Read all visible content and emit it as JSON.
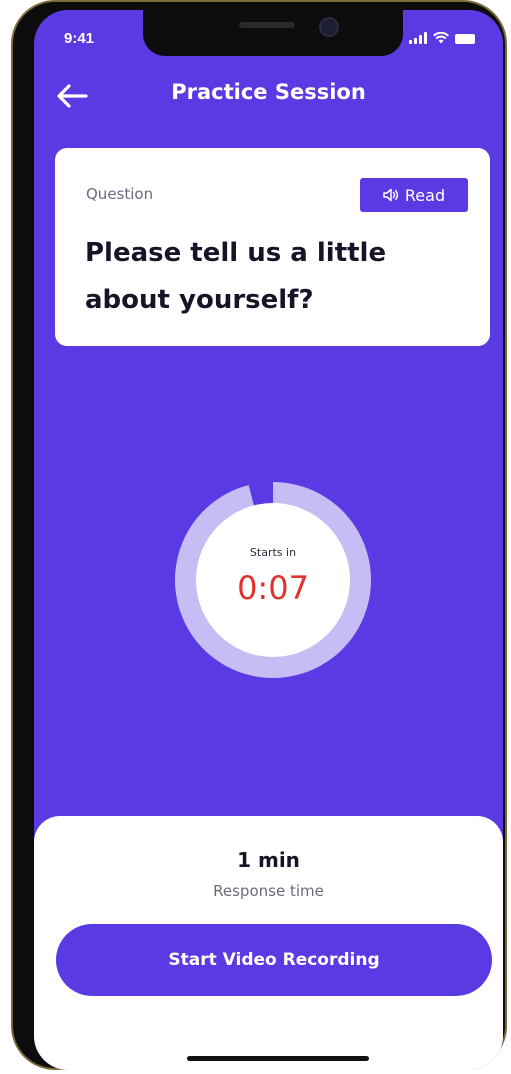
{
  "status_bar": {
    "time": "9:41",
    "icons": [
      "signal-icon",
      "wifi-icon",
      "battery-icon"
    ]
  },
  "header": {
    "back_icon": "arrow-left-icon",
    "title": "Practice Session"
  },
  "question_card": {
    "label": "Question",
    "read_button_label": "Read",
    "read_icon": "speaker-icon",
    "text": "Please tell us a little about yourself?"
  },
  "timer": {
    "label": "Starts in",
    "countdown": "0:07",
    "progress_fraction": 0.96
  },
  "bottom_sheet": {
    "response_value": "1 min",
    "response_label": "Response time",
    "record_button_label": "Start Video Recording"
  },
  "colors": {
    "primary": "#5b3ae3",
    "ring_track": "#c7bdf5",
    "countdown": "#e0322e",
    "card": "#ffffff"
  }
}
